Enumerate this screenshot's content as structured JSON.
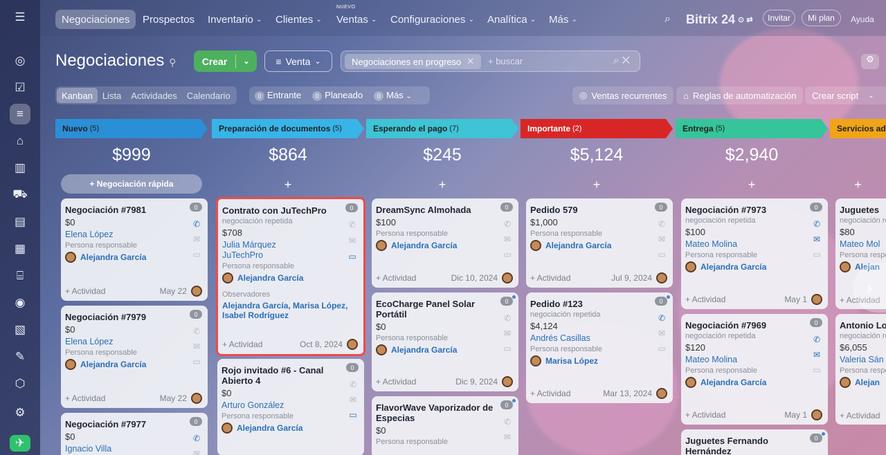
{
  "nav": {
    "items": [
      "Negociaciones",
      "Prospectos",
      "Inventario",
      "Clientes",
      "Ventas",
      "Configuraciones",
      "Analítica",
      "Más"
    ],
    "new_label": "NUEVO",
    "brand": "Bitrix 24",
    "invite": "Invitar",
    "plan": "Mi plan",
    "help": "Ayuda"
  },
  "header": {
    "title": "Negociaciones",
    "create": "Crear",
    "pipeline": "Venta",
    "filter_chip": "Negociaciones en progreso",
    "search_placeholder": "+ buscar"
  },
  "views": {
    "tabs": [
      "Kanban",
      "Lista",
      "Actividades",
      "Calendario"
    ],
    "counters": [
      {
        "n": "0",
        "label": "Entrante"
      },
      {
        "n": "0",
        "label": "Planeado"
      },
      {
        "n": "0",
        "label": "Más"
      }
    ],
    "recurring": "Ventas recurrentes",
    "automation": "Reglas de automatización",
    "script": "Crear script"
  },
  "common": {
    "activity": "+ Actividad",
    "resp_label": "Persona responsable",
    "repeat": "negociación repetida",
    "observers": "Observadores",
    "quick": "+ Negociación rápida",
    "plus": "+"
  },
  "columns": [
    {
      "name": "Nuevo",
      "count": "(5)",
      "sum": "$999",
      "color": "#2b8fd6",
      "cards": [
        {
          "title": "Negociación #7981",
          "price": "$0",
          "client": "Elena López",
          "resp": "Alejandra García",
          "date": "May 22",
          "badge": "0"
        },
        {
          "title": "Negociación #7979",
          "price": "$0",
          "client": "Elena López",
          "resp": "Alejandra García",
          "date": "May 22",
          "badge": "0"
        },
        {
          "title": "Negociación #7977",
          "price": "$0",
          "client": "Ignacio Villa",
          "badge": "0"
        }
      ]
    },
    {
      "name": "Preparación de documentos",
      "count": "(5)",
      "sum": "$864",
      "color": "#38b4e8",
      "cards": [
        {
          "title": "Contrato con JuTechPro",
          "price": "$708",
          "client": "Julia Márquez",
          "company": "JuTechPro",
          "resp": "Alejandra García",
          "observers": "Alejandra García, Marisa López, Isabel Rodríguez",
          "date": "Oct 8, 2024",
          "badge": "0"
        },
        {
          "title": "Rojo invitado #6 - Canal Abierto 4",
          "price": "$0",
          "client": "Arturo González",
          "resp": "Alejandra García",
          "badge": "0"
        }
      ]
    },
    {
      "name": "Esperando el pago",
      "count": "(7)",
      "sum": "$245",
      "color": "#3ec4d4",
      "cards": [
        {
          "title": "DreamSync Almohada",
          "price": "$100",
          "resp": "Alejandra García",
          "date": "Dic 10, 2024",
          "badge": "0"
        },
        {
          "title": "EcoCharge Panel Solar Portátil",
          "price": "$0",
          "resp": "Alejandra García",
          "date": "Dic 9, 2024",
          "badge": "0"
        },
        {
          "title": "FlavorWave Vaporizador de Especias",
          "price": "$0",
          "badge": "0"
        }
      ]
    },
    {
      "name": "Importante",
      "count": "(2)",
      "sum": "$5,124",
      "color": "#d82626",
      "cards": [
        {
          "title": "Pedido 579",
          "price": "$1,000",
          "resp": "Alejandra García",
          "date": "Jul 9, 2024",
          "badge": "0"
        },
        {
          "title": "Pedido #123",
          "price": "$4,124",
          "client": "Andrés Casillas",
          "resp": "Marisa López",
          "date": "Mar 13, 2024",
          "badge": "0"
        }
      ]
    },
    {
      "name": "Entrega",
      "count": "(5)",
      "sum": "$2,940",
      "color": "#36c49a",
      "cards": [
        {
          "title": "Negociación #7973",
          "price": "$100",
          "client": "Mateo Molina",
          "resp": "Alejandra García",
          "date": "May 1",
          "badge": "0"
        },
        {
          "title": "Negociación #7969",
          "price": "$120",
          "client": "Mateo Molina",
          "resp": "Alejandra García",
          "date": "May 1",
          "badge": "0"
        },
        {
          "title": "Juguetes Fernando Hernández",
          "badge": "0"
        }
      ]
    },
    {
      "name": "Servicios ad",
      "color": "#f0a418",
      "cards": [
        {
          "title": "Juguetes",
          "price": "$80",
          "client": "Mateo Mol",
          "resp": "Alejan"
        },
        {
          "title": "Antonio Lo",
          "price": "$6,055",
          "client": "Valeria Sán",
          "resp": "Alejan"
        }
      ]
    }
  ]
}
